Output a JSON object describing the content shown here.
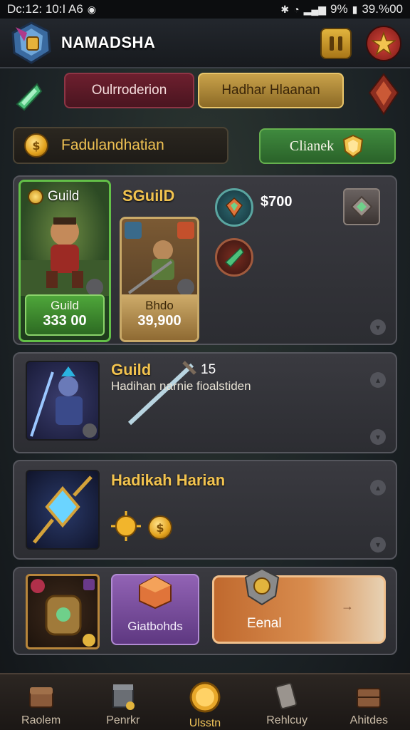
{
  "status_bar": {
    "time": "Dc:12: 10:I A6",
    "battery": "9%",
    "right_time": "39.%00"
  },
  "header": {
    "title": "NAMADSHA"
  },
  "tabs": [
    {
      "label": "Oulrroderion"
    },
    {
      "label": "Hadhar Hlaanan"
    }
  ],
  "search": {
    "text": "Fadulandhatian"
  },
  "claim": {
    "label": "Clianek"
  },
  "featured": {
    "guild_card": {
      "top_label": "Guild",
      "price_label": "Guild",
      "price_value": "333 00"
    },
    "sguild_title": "SGuilD",
    "sguild_card": {
      "price_label": "Bhdo",
      "price_value": "39,900"
    },
    "price_right": "$700"
  },
  "item_2": {
    "title": "Guild",
    "count": "15",
    "description": "Hadihan narnie fioalstiden"
  },
  "item_3": {
    "title": "Hadikah Harian"
  },
  "actions": {
    "guild_button": "Giatbohds",
    "final_button": "Eenal"
  },
  "bottom_nav": [
    {
      "label": "Raolem",
      "icon": "chest-icon"
    },
    {
      "label": "Penrkr",
      "icon": "shop-icon"
    },
    {
      "label": "Ulsstn",
      "icon": "coin-icon",
      "active": true
    },
    {
      "label": "Rehlcuy",
      "icon": "scroll-icon"
    },
    {
      "label": "Ahitdes",
      "icon": "crate-icon"
    }
  ],
  "colors": {
    "accent_gold": "#f2c34f",
    "green": "#3f8a3e",
    "purple": "#9263b5",
    "orange": "#c0692e"
  }
}
